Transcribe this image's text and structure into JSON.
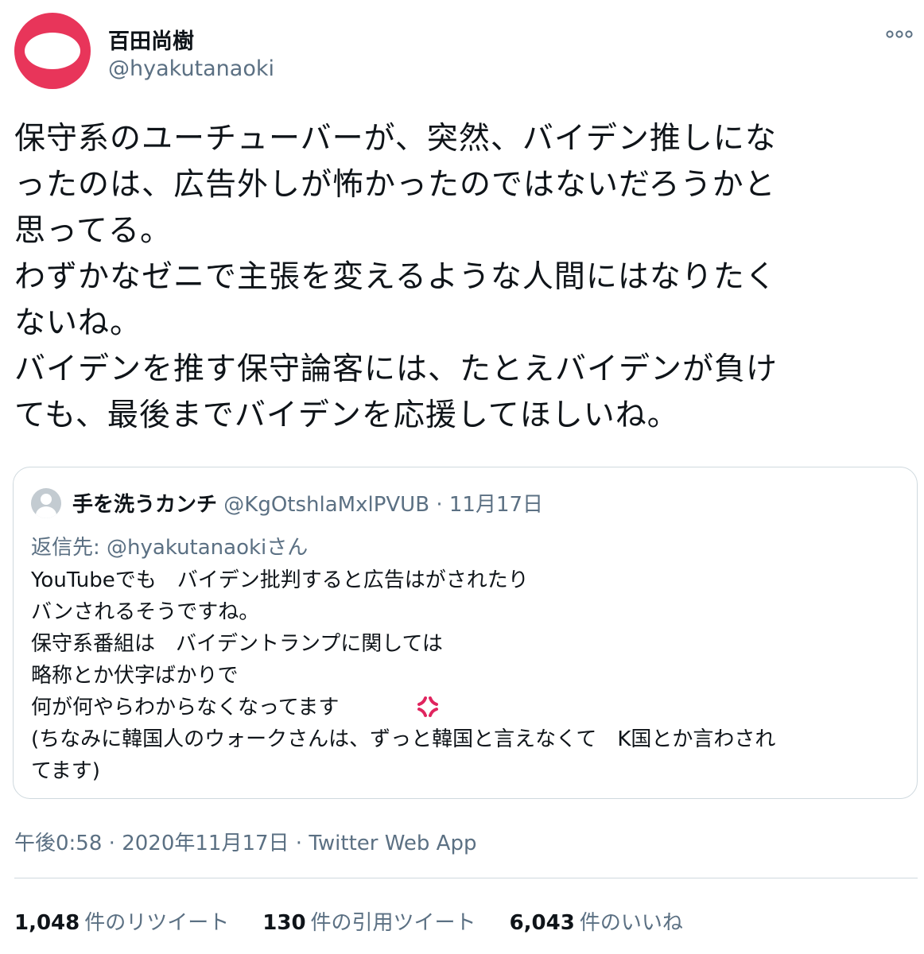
{
  "author": {
    "display_name": "百田尚樹",
    "handle": "@hyakutanaoki",
    "avatar_colors": {
      "ring": "#e8355a",
      "center": "#ffffff"
    }
  },
  "more_icon": "more-horizontal-icon",
  "tweet_text": "保守系のユーチューバーが、突然、バイデン推しにな\nったのは、広告外しが怖かったのではないだろうかと\n思ってる。\nわずかなゼニで主張を変えるような人間にはなりたく\nないね。\nバイデンを推す保守論客には、たとえバイデンが負け\nても、最後までバイデンを応援してほしいね。",
  "quoted_tweet": {
    "display_name": "手を洗うカンチ",
    "handle": "@KgOtshlaMxlPVUB",
    "separator": "·",
    "date": "11月17日",
    "reply_to": "返信先: @hyakutanaokiさん",
    "body": "YouTubeでも　バイデン批判すると広告はがされたり\nバンされるそうですね。\n保守系番組は　バイデントランプに関しては\n略称とか伏字ばかりで\n何が何やらわからなくなってます\n(ちなみに韓国人のウォークさんは、ずっと韓国と言えなくて　K国とか言わされ\nてます)",
    "emoji": "anger-symbol-icon"
  },
  "meta": {
    "time": "午後0:58",
    "separator": "·",
    "date": "2020年11月17日",
    "app": "Twitter Web App"
  },
  "stats": {
    "retweets_count": "1,048",
    "retweets_label": "件のリツイート",
    "quotes_count": "130",
    "quotes_label": "件の引用ツイート",
    "likes_count": "6,043",
    "likes_label": "件のいいね"
  },
  "colors": {
    "text": "#0f1419",
    "secondary": "#5b7083",
    "border": "#cfd9de",
    "anger": "#e0245e"
  }
}
